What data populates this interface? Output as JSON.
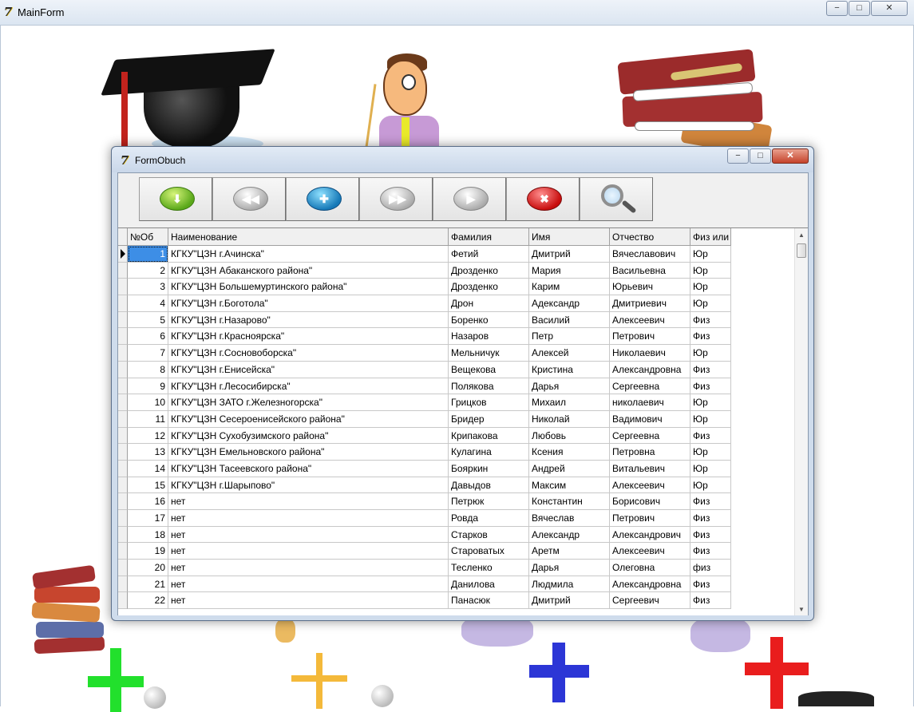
{
  "main_window": {
    "title": "MainForm",
    "icon": "delphi-app-icon",
    "minimize": "−",
    "maximize": "□",
    "close": "✕"
  },
  "form_obuch": {
    "title": "FormObuch",
    "icon": "delphi-app-icon",
    "minimize": "−",
    "maximize": "□",
    "close": "✕",
    "toolbar": [
      {
        "name": "download-green-button",
        "icon": "arrow-down-icon",
        "glyph": "⬇",
        "style": "orb-green"
      },
      {
        "name": "first-record-button",
        "icon": "rewind-icon",
        "glyph": "◀◀",
        "style": "orb-grey"
      },
      {
        "name": "add-record-button",
        "icon": "plus-icon",
        "glyph": "✚",
        "style": "orb-blue"
      },
      {
        "name": "last-record-button",
        "icon": "fast-forward-icon",
        "glyph": "▶▶",
        "style": "orb-grey"
      },
      {
        "name": "next-record-button",
        "icon": "play-icon",
        "glyph": "▶",
        "style": "orb-grey"
      },
      {
        "name": "delete-record-button",
        "icon": "delete-x-icon",
        "glyph": "✖",
        "style": "orb-red"
      },
      {
        "name": "search-button",
        "icon": "magnifier-icon",
        "glyph": "",
        "style": "magnifier"
      }
    ],
    "columns": [
      "№Об",
      "Наименование",
      "Фамилия",
      "Имя",
      "Отчество",
      "Физ или"
    ],
    "selected_row": 0,
    "rows": [
      [
        "1",
        "КГКУ\"ЦЗН г.Ачинска\"",
        "Фетий",
        "Дмитрий",
        "Вячеславович",
        "Юр"
      ],
      [
        "2",
        "КГКУ\"ЦЗН Абаканского района\"",
        "Дрозденко",
        "Мария",
        "Васильевна",
        "Юр"
      ],
      [
        "3",
        "КГКУ\"ЦЗН Большемуртинского района\"",
        "Дрозденко",
        "Карим",
        "Юрьевич",
        "Юр"
      ],
      [
        "4",
        "КГКУ\"ЦЗН г.Боготола\"",
        "Дрон",
        "Адександр",
        "Дмитриевич",
        "Юр"
      ],
      [
        "5",
        "КГКУ\"ЦЗН г.Назарово\"",
        "Боренко",
        "Василий",
        "Алексеевич",
        "Физ"
      ],
      [
        "6",
        "КГКУ\"ЦЗН г.Красноярска\"",
        "Назаров",
        "Петр",
        "Петрович",
        "Физ"
      ],
      [
        "7",
        "КГКУ\"ЦЗН г.Сосновоборска\"",
        "Мельничук",
        "Алексей",
        "Николаевич",
        "Юр"
      ],
      [
        "8",
        "КГКУ\"ЦЗН г.Енисейска\"",
        "Вещекова",
        "Кристина",
        "Александровна",
        "Физ"
      ],
      [
        "9",
        "КГКУ\"ЦЗН г.Лесосибирска\"",
        "Полякова",
        "Дарья",
        "Сергеевна",
        "Физ"
      ],
      [
        "10",
        "КГКУ\"ЦЗН ЗАТО г.Железногорска\"",
        "Грицков",
        "Михаил",
        "николаевич",
        "Юр"
      ],
      [
        "11",
        "КГКУ\"ЦЗН Сесероенисейского района\"",
        "Бридер",
        "Николай",
        "Вадимович",
        "Юр"
      ],
      [
        "12",
        "КГКУ\"ЦЗН Сухобузимского района\"",
        "Крипакова",
        "Любовь",
        "Сергеевна",
        "Физ"
      ],
      [
        "13",
        "КГКУ\"ЦЗН Емельновского района\"",
        "Кулагина",
        "Ксения",
        "Петровна",
        "Юр"
      ],
      [
        "14",
        "КГКУ\"ЦЗН Тасеевского района\"",
        "Бояркин",
        "Андрей",
        "Витальевич",
        "Юр"
      ],
      [
        "15",
        "КГКУ\"ЦЗН г.Шарыпово\"",
        "Давыдов",
        "Максим",
        "Алексеевич",
        "Юр"
      ],
      [
        "16",
        "нет",
        "Петрюк",
        "Константин",
        "Борисович",
        "Физ"
      ],
      [
        "17",
        "нет",
        "Ровда",
        "Вячеслав",
        "Петрович",
        "Физ"
      ],
      [
        "18",
        "нет",
        "Старков",
        "Александр",
        "Александрович",
        "Физ"
      ],
      [
        "19",
        "нет",
        "Староватых",
        "Аретм",
        "Алексеевич",
        "Физ"
      ],
      [
        "20",
        "нет",
        "Тесленко",
        "Дарья",
        "Олеговна",
        "физ"
      ],
      [
        "21",
        "нет",
        "Данилова",
        "Людмила",
        "Александровна",
        "Физ"
      ],
      [
        "22",
        "нет",
        "Панасюк",
        "Дмитрий",
        "Сергеевич",
        "Физ"
      ]
    ],
    "scroll_up": "▲",
    "scroll_down": "▼"
  },
  "colors": {
    "selection": "#3d8ee6",
    "plus_green": "#22e02c",
    "plus_orange": "#f4b93a",
    "plus_blue": "#2c36d6",
    "plus_red": "#e91d1d"
  }
}
